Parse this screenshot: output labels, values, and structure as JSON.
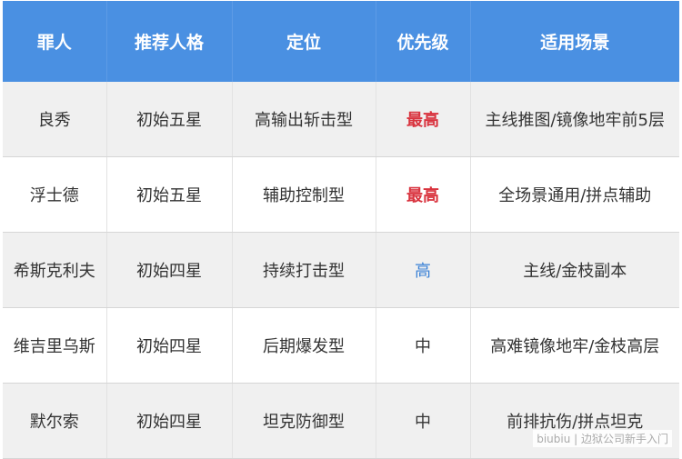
{
  "table": {
    "headers": [
      "罪人",
      "推荐人格",
      "定位",
      "优先级",
      "适用场景"
    ],
    "rows": [
      {
        "sinner": "良秀",
        "persona": "初始五星",
        "role": "高输出斩击型",
        "priority": "最高",
        "priority_level": "top",
        "scenario": "主线推图/镜像地牢前5层"
      },
      {
        "sinner": "浮士德",
        "persona": "初始五星",
        "role": "辅助控制型",
        "priority": "最高",
        "priority_level": "top",
        "scenario": "全场景通用/拼点辅助"
      },
      {
        "sinner": "希斯克利夫",
        "persona": "初始四星",
        "role": "持续打击型",
        "priority": "高",
        "priority_level": "high",
        "scenario": "主线/金枝副本"
      },
      {
        "sinner": "维吉里乌斯",
        "persona": "初始四星",
        "role": "后期爆发型",
        "priority": "中",
        "priority_level": "mid",
        "scenario": "高难镜像地牢/金枝高层"
      },
      {
        "sinner": "默尔索",
        "persona": "初始四星",
        "role": "坦克防御型",
        "priority": "中",
        "priority_level": "mid",
        "scenario": "前排抗伤/拼点坦克"
      }
    ]
  },
  "colors": {
    "header_bg": "#4a90e2",
    "priority_top": "#d9343f",
    "priority_high": "#3b82d6",
    "row_alt_bg": "#f0f0f0"
  },
  "watermark": "biubiu | 边狱公司新手入门"
}
